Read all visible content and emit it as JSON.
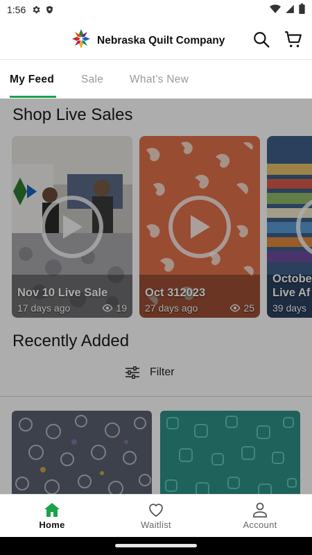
{
  "status_bar": {
    "time": "1:56",
    "icons": [
      "gear-icon",
      "shield-icon",
      "wifi-icon",
      "signal-icon",
      "battery-icon"
    ]
  },
  "header": {
    "brand_name": "Nebraska Quilt Company",
    "icons": [
      "quilt-logo",
      "search-icon",
      "cart-icon"
    ]
  },
  "tabs": [
    {
      "label": "My Feed",
      "active": true
    },
    {
      "label": "Sale",
      "active": false
    },
    {
      "label": "What's New",
      "active": false
    }
  ],
  "live_sales": {
    "heading": "Shop Live Sales",
    "cards": [
      {
        "title": "Nov 10 Live Sale",
        "age": "17 days ago",
        "views": "19"
      },
      {
        "title": "Oct 312023",
        "age": "27 days ago",
        "views": "25"
      },
      {
        "title": "Octobe",
        "title2": "Live Af",
        "age": "39 days"
      }
    ]
  },
  "recently_added": {
    "heading": "Recently Added",
    "filter_label": "Filter"
  },
  "bottom_nav": [
    {
      "label": "Home",
      "icon": "home-icon",
      "active": true
    },
    {
      "label": "Waitlist",
      "icon": "heart-icon",
      "active": false
    },
    {
      "label": "Account",
      "icon": "person-icon",
      "active": false
    }
  ],
  "colors": {
    "accent": "#19a24a",
    "coral": "#e0714b",
    "teal": "#2f8f86"
  }
}
